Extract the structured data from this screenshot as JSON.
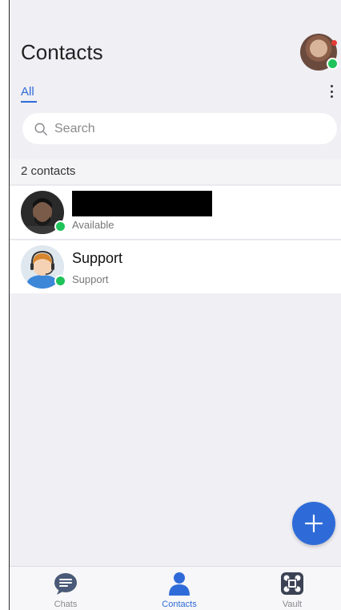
{
  "header": {
    "title": "Contacts"
  },
  "filter": {
    "all_label": "All"
  },
  "search": {
    "placeholder": "Search"
  },
  "contacts": {
    "count_label": "2 contacts",
    "items": [
      {
        "name": "",
        "status": "Available",
        "online": true
      },
      {
        "name": "Support",
        "status": "Support",
        "online": true
      }
    ]
  },
  "tabbar": {
    "tabs": [
      {
        "label": "Chats",
        "active": false
      },
      {
        "label": "Contacts",
        "active": true
      },
      {
        "label": "Vault",
        "active": false
      }
    ]
  },
  "colors": {
    "accent": "#2f6bd8",
    "online": "#20c35a",
    "notification": "#e53935",
    "background": "#efeff4"
  }
}
